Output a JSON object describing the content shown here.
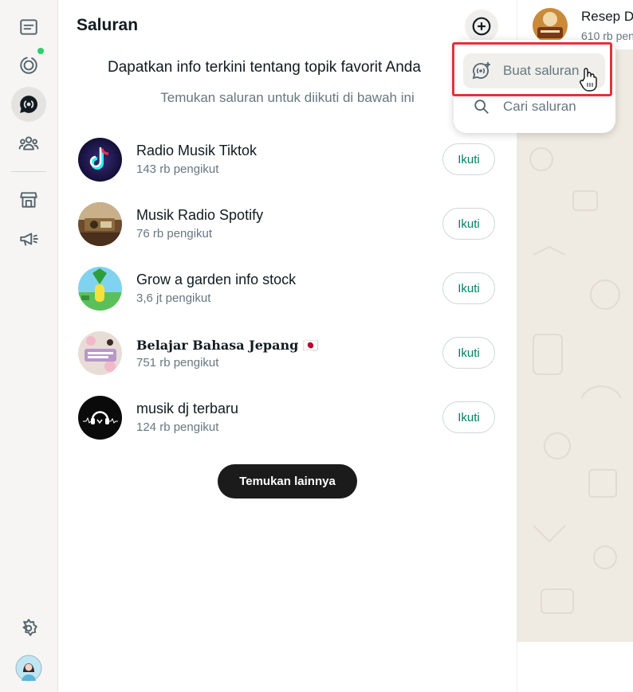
{
  "sidebar": {
    "icons": [
      "chats-icon",
      "status-icon",
      "channels-icon",
      "communities-icon",
      "shop-icon",
      "megaphone-icon",
      "settings-icon",
      "profile-avatar"
    ]
  },
  "panel": {
    "title": "Saluran",
    "headline": "Dapatkan info terkini tentang topik favorit Anda",
    "subline": "Temukan saluran untuk diikuti di bawah ini",
    "more_button": "Temukan lainnya"
  },
  "channels": [
    {
      "name": "Radio Musik Tiktok",
      "followers": "143 rb pengikut",
      "follow_label": "Ikuti"
    },
    {
      "name": "Musik Radio Spotify",
      "followers": "76 rb pengikut",
      "follow_label": "Ikuti"
    },
    {
      "name": "Grow a garden info stock",
      "followers": "3,6 jt pengikut",
      "follow_label": "Ikuti"
    },
    {
      "name": "Belajar Bahasa Jepang 🇯🇵",
      "followers": "751 rb pengikut",
      "follow_label": "Ikuti"
    },
    {
      "name": "musik dj terbaru",
      "followers": "124 rb pengikut",
      "follow_label": "Ikuti"
    }
  ],
  "menu": {
    "create_label": "Buat saluran",
    "search_label": "Cari saluran"
  },
  "right_preview": {
    "name": "Resep D",
    "followers": "610 rb pen"
  },
  "colors": {
    "accent": "#008069",
    "status_dot": "#25d366",
    "highlight": "#e0333a"
  }
}
